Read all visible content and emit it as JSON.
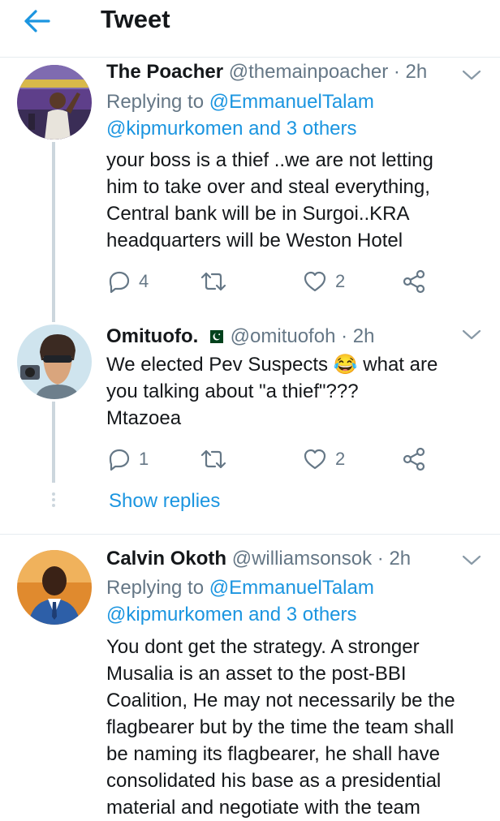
{
  "header": {
    "title": "Tweet",
    "back_icon": "arrow-left-icon",
    "accent": "#1b95e0"
  },
  "tweets": [
    {
      "name": "The Poacher",
      "handle": "@themainpoacher",
      "time": "· 2h",
      "replying_prefix": "Replying to ",
      "replying_user": "@EmmanuelTalam",
      "replying_others": "@kipmurkomen and 3 others",
      "lines": [
        "your boss is a thief ..we are not letting",
        "him to take over and steal everything,",
        "Central bank will be in Surgoi..KRA",
        "headquarters will be Weston Hotel"
      ],
      "reply_count": "4",
      "retweet_count": "",
      "like_count": "2"
    },
    {
      "name": "Omituofo.",
      "flag": "pakistan-flag-icon",
      "handle": "@omituofoh",
      "time": "· 2h",
      "line1_before": "We elected Pev Suspects ",
      "emoji": "😂",
      "line1_after": " what are",
      "lines": [
        "you talking about \"a thief\"???",
        "Mtazoea"
      ],
      "reply_count": "1",
      "retweet_count": "",
      "like_count": "2",
      "show_replies": "Show replies"
    },
    {
      "name": "Calvin Okoth",
      "handle": "@williamsonsok",
      "time": "· 2h",
      "replying_prefix": "Replying to ",
      "replying_user": "@EmmanuelTalam",
      "replying_others": "@kipmurkomen and 3 others",
      "lines": [
        "You dont get the strategy. A stronger",
        "Musalia is an asset to the post-BBI",
        "Coalition, He may not necessarily be the",
        "flagbearer but by the time the team shall",
        "be naming its flagbearer, he shall have",
        "consolidated his base as a presidential",
        "material and negotiate with the team"
      ]
    }
  ]
}
